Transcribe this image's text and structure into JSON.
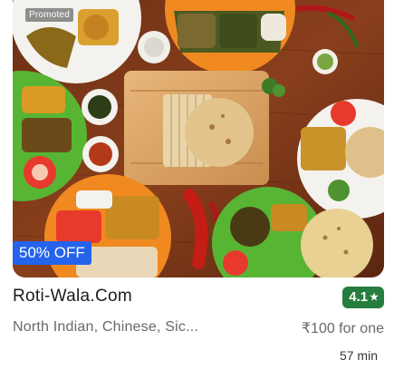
{
  "restaurant": {
    "name": "Roti-Wala.Com",
    "rating": "4.1",
    "rating_star": "★",
    "cuisines": "North Indian, Chinese, Sic...",
    "price": "₹100 for one",
    "delivery_time": "57 min"
  },
  "badges": {
    "promoted": "Promoted",
    "offer": "50% OFF"
  },
  "colors": {
    "rating_bg": "#267e3e",
    "offer_bg": "#2563eb",
    "text_primary": "#1c1c1c",
    "text_secondary": "#696969"
  },
  "image": {
    "subject": "food-photo-thali-platters-with-rotis"
  }
}
